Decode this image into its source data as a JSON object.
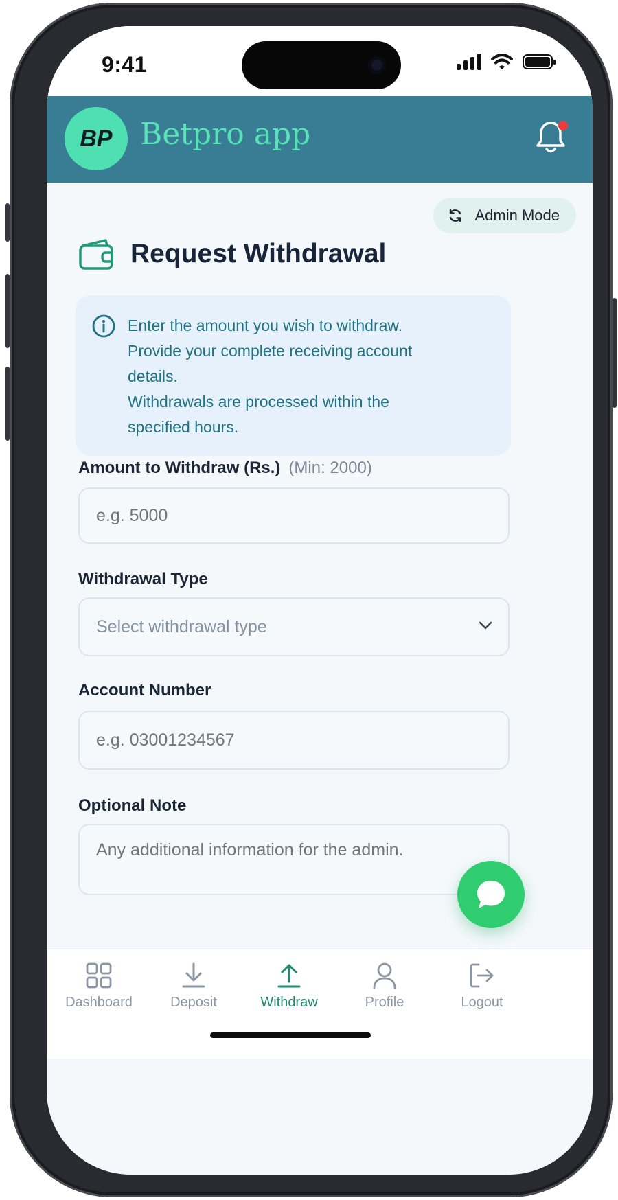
{
  "status_bar": {
    "time": "9:41"
  },
  "app_header": {
    "logo_text": "BP",
    "app_name": "Betpro app"
  },
  "admin_mode": {
    "label": "Admin Mode"
  },
  "page": {
    "title": "Request Withdrawal"
  },
  "info_box": {
    "lines": [
      "Enter the amount you wish to withdraw.",
      "Provide your complete receiving account",
      "details.",
      "Withdrawals are processed within the",
      "specified hours."
    ]
  },
  "form": {
    "amount": {
      "label": "Amount to Withdraw (Rs.)",
      "hint": "(Min: 2000)",
      "placeholder": "e.g. 5000",
      "value": ""
    },
    "withdrawal_type": {
      "label": "Withdrawal Type",
      "selected": "Select withdrawal type"
    },
    "account_number": {
      "label": "Account Number",
      "placeholder": "e.g. 03001234567",
      "value": ""
    },
    "note": {
      "label": "Optional Note",
      "placeholder": "Any additional information for the admin.",
      "value": ""
    }
  },
  "bottom_nav": {
    "items": [
      {
        "label": "Dashboard",
        "icon": "grid-icon",
        "active": false
      },
      {
        "label": "Deposit",
        "icon": "download-icon",
        "active": false
      },
      {
        "label": "Withdraw",
        "icon": "upload-icon",
        "active": true
      },
      {
        "label": "Profile",
        "icon": "user-icon",
        "active": false
      },
      {
        "label": "Logout",
        "icon": "logout-icon",
        "active": false
      }
    ]
  },
  "colors": {
    "header_bg": "#387d94",
    "brand_green": "#4fe0b1",
    "active_nav": "#1e8a6e",
    "info_bg": "#e7f1fb",
    "info_text": "#1f7384",
    "chat_fab": "#2fcc70",
    "notification_dot": "#ef3b3b"
  }
}
